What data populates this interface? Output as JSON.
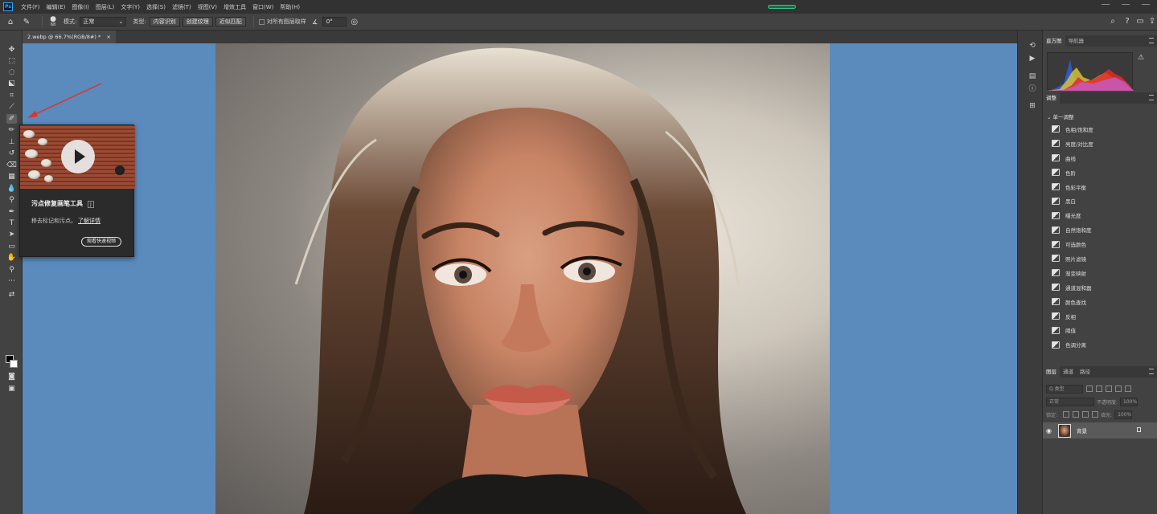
{
  "app": {
    "logo": "Ps"
  },
  "menu": [
    "文件(F)",
    "编辑(E)",
    "图像(I)",
    "图层(L)",
    "文字(Y)",
    "选择(S)",
    "滤镜(T)",
    "视图(V)",
    "增效工具",
    "窗口(W)",
    "帮助(H)"
  ],
  "options": {
    "brush_size": "68",
    "mode_label": "模式:",
    "mode_value": "正常",
    "type_label": "类型:",
    "type_options": [
      "内容识别",
      "创建纹理",
      "近似匹配"
    ],
    "sample_all_layers": "对所有图层取样",
    "angle": "0°"
  },
  "document": {
    "tab_title": "2.webp @ 66.7%(RGB/8#) *",
    "close_glyph": "×"
  },
  "tooltip": {
    "title": "污点修复画笔工具",
    "shortcut": "J",
    "description": "移去标记和污点。",
    "learn_more": "了解详情",
    "watch_button": "观看快速视频"
  },
  "panels": {
    "histogram_tabs": [
      "直方图",
      "导航器"
    ],
    "adjustments_tab": "调整",
    "adjustments_header": "单一调整",
    "adjustments": [
      "色相/饱和度",
      "亮度/对比度",
      "曲线",
      "色阶",
      "色彩平衡",
      "黑白",
      "曝光度",
      "自然饱和度",
      "可选颜色",
      "照片滤镜",
      "渐变映射",
      "通道混和器",
      "颜色查找",
      "反相",
      "阈值",
      "色调分离"
    ],
    "layers_tabs": [
      "图层",
      "通道",
      "路径"
    ],
    "layer_kind_placeholder": "Q 类型",
    "blend_mode": "正常",
    "opacity_label": "不透明度:",
    "opacity_value": "100%",
    "lock_label": "锁定:",
    "fill_label": "填充:",
    "fill_value": "100%",
    "layer_name": "背景"
  },
  "colors": {
    "canvas_bg": "#5b8abd",
    "ui_dark": "#323232",
    "ui_panel": "#424242",
    "accent": "#31a8ff"
  }
}
